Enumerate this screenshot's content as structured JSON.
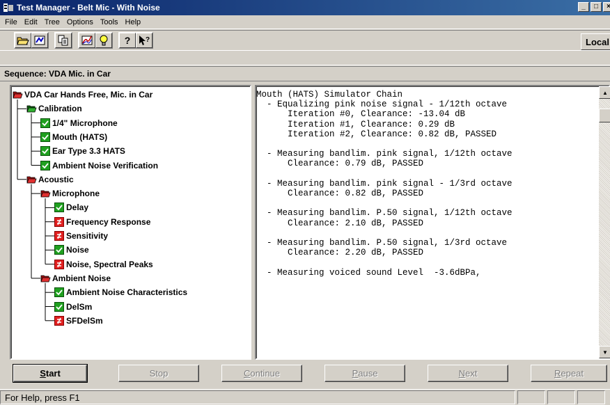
{
  "window": {
    "title": "Test Manager - Belt Mic - With Noise",
    "controls": [
      "_",
      "□",
      "×"
    ]
  },
  "menu": [
    "File",
    "Edit",
    "Tree",
    "Options",
    "Tools",
    "Help"
  ],
  "toolbar": {
    "local_label": "Local",
    "groups": [
      [
        "open-folder-icon",
        "edit-sequence-icon"
      ],
      [
        "copy-icon"
      ],
      [
        "chart-icon",
        "lightbulb-icon"
      ],
      [
        "help-icon",
        "context-help-icon"
      ]
    ]
  },
  "sequence": {
    "label": "Sequence: VDA Mic. in Car"
  },
  "tree": {
    "nodes": [
      {
        "label": "VDA Car Hands Free, Mic. in Car",
        "icon": "folder-open-red",
        "level": 0
      },
      {
        "label": "Calibration",
        "icon": "folder-open-green",
        "level": 1
      },
      {
        "label": "1/4\" Microphone",
        "icon": "check-green",
        "level": 2
      },
      {
        "label": "Mouth (HATS)",
        "icon": "check-green",
        "level": 2
      },
      {
        "label": "Ear Type 3.3 HATS",
        "icon": "check-green",
        "level": 2
      },
      {
        "label": "Ambient Noise Verification",
        "icon": "check-green",
        "level": 2
      },
      {
        "label": "Acoustic",
        "icon": "folder-open-red",
        "level": 1
      },
      {
        "label": "Microphone",
        "icon": "folder-open-red",
        "level": 2
      },
      {
        "label": "Delay",
        "icon": "check-green",
        "level": 3
      },
      {
        "label": "Frequency Response",
        "icon": "fail-red",
        "level": 3
      },
      {
        "label": "Sensitivity",
        "icon": "fail-red",
        "level": 3
      },
      {
        "label": "Noise",
        "icon": "check-green",
        "level": 3
      },
      {
        "label": "Noise, Spectral Peaks",
        "icon": "fail-red",
        "level": 3
      },
      {
        "label": "Ambient Noise",
        "icon": "folder-open-red",
        "level": 2
      },
      {
        "label": "Ambient Noise Characteristics",
        "icon": "check-green",
        "level": 3
      },
      {
        "label": "DelSm",
        "icon": "check-green",
        "level": 3
      },
      {
        "label": "SFDelSm",
        "icon": "fail-red",
        "level": 3
      }
    ]
  },
  "log": {
    "text": "Mouth (HATS) Simulator Chain\n  - Equalizing pink noise signal - 1/12th octave\n      Iteration #0, Clearance: -13.04 dB\n      Iteration #1, Clearance: 0.29 dB\n      Iteration #2, Clearance: 0.82 dB, PASSED\n\n  - Measuring bandlim. pink signal, 1/12th octave\n      Clearance: 0.79 dB, PASSED\n\n  - Measuring bandlim. pink signal - 1/3rd octave\n      Clearance: 0.82 dB, PASSED\n\n  - Measuring bandlim. P.50 signal, 1/12th octave\n      Clearance: 2.10 dB, PASSED\n\n  - Measuring bandlim. P.50 signal, 1/3rd octave\n      Clearance: 2.20 dB, PASSED\n\n  - Measuring voiced sound Level  -3.6dBPa,"
  },
  "buttons": {
    "start": {
      "pre": "",
      "key": "S",
      "post": "tart"
    },
    "stop": {
      "pre": "Stop",
      "key": "",
      "post": ""
    },
    "continue": {
      "pre": "",
      "key": "C",
      "post": "ontinue"
    },
    "pause": {
      "pre": "",
      "key": "P",
      "post": "ause"
    },
    "next": {
      "pre": "",
      "key": "N",
      "post": "ext"
    },
    "repeat": {
      "pre": "",
      "key": "R",
      "post": "epeat"
    }
  },
  "status": {
    "text": "For Help, press F1"
  },
  "colors": {
    "titlebar": "#0a246a",
    "check": "#1fa01f",
    "fail": "#e02020",
    "folder": "#cc1f1f"
  }
}
